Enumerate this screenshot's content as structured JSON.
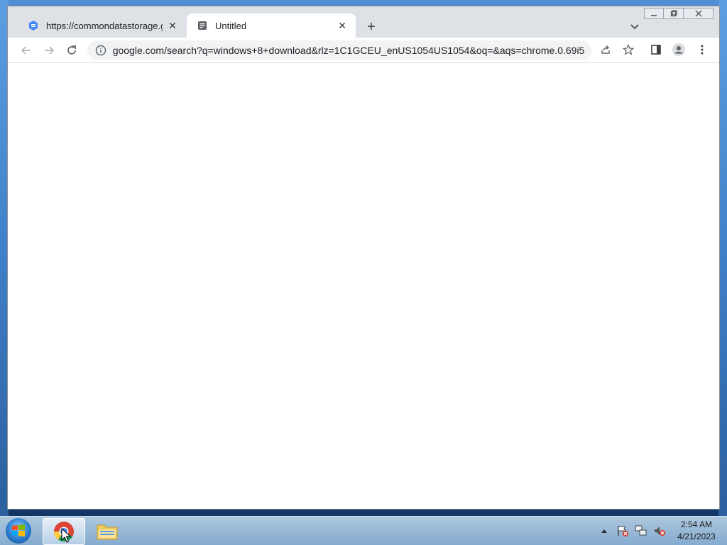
{
  "browser": {
    "tabs": [
      {
        "title": "https://commondatastorage.goo",
        "favicon": "google-cloud-icon",
        "active": false
      },
      {
        "title": "Untitled",
        "favicon": "document-icon",
        "active": true
      }
    ],
    "address": "google.com/search?q=windows+8+download&rlz=1C1GCEU_enUS1054US1054&oq=&aqs=chrome.0.69i5..."
  },
  "taskbar": {
    "time": "2:54 AM",
    "date": "4/21/2023"
  },
  "colors": {
    "chrome_tab_bg": "#dee1e6",
    "toolbar_bg": "#ffffff",
    "omnibox_bg": "#f1f3f4"
  }
}
